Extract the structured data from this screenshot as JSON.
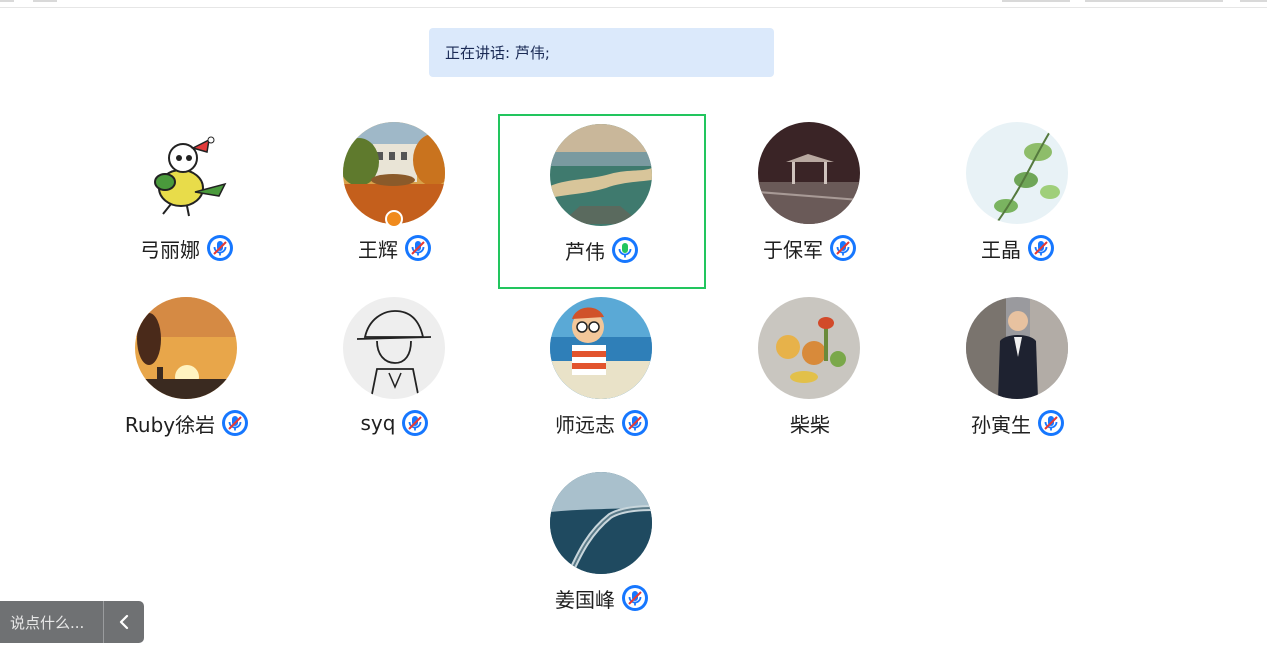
{
  "banner": {
    "prefix": "正在讲话:",
    "speaker": "芦伟;"
  },
  "colors": {
    "active_border": "#22c55e",
    "mic_muted": "#1677ff",
    "mic_active": "#1677ff",
    "banner_bg": "#dbe9fb"
  },
  "participants": [
    {
      "name": "弓丽娜",
      "mic": "muted",
      "avatar": "cartoon-bird"
    },
    {
      "name": "王辉",
      "mic": "muted",
      "avatar": "autumn-building",
      "badge": "host-icon"
    },
    {
      "name": "芦伟",
      "mic": "speaking",
      "avatar": "river-landscape",
      "active": true
    },
    {
      "name": "于保军",
      "mic": "muted",
      "avatar": "night-pavilion"
    },
    {
      "name": "王晶",
      "mic": "muted",
      "avatar": "green-leaves"
    },
    {
      "name": "Ruby徐岩",
      "mic": "muted",
      "avatar": "sunset-sky"
    },
    {
      "name": "syq",
      "mic": "muted",
      "avatar": "line-drawing-hat"
    },
    {
      "name": "师远志",
      "mic": "muted",
      "avatar": "cartoon-boy-sea"
    },
    {
      "name": "柴柴",
      "mic": "none",
      "avatar": "toy-figures"
    },
    {
      "name": "孙寅生",
      "mic": "muted",
      "avatar": "man-portrait"
    },
    {
      "name": "姜国峰",
      "mic": "muted",
      "avatar": "sea-bridge"
    }
  ],
  "chat": {
    "placeholder": "说点什么..."
  }
}
